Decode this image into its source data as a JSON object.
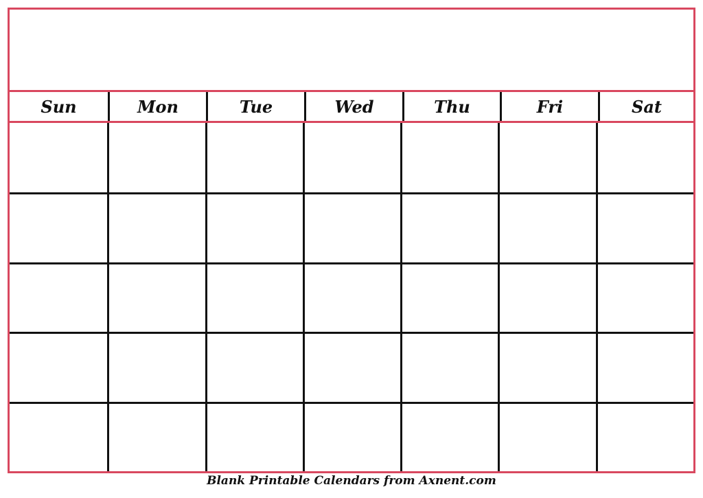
{
  "calendar": {
    "title": "",
    "weekdays": [
      "Sun",
      "Mon",
      "Tue",
      "Wed",
      "Thu",
      "Fri",
      "Sat"
    ],
    "rows": 5,
    "cells": [
      [
        "",
        "",
        "",
        "",
        "",
        "",
        ""
      ],
      [
        "",
        "",
        "",
        "",
        "",
        "",
        ""
      ],
      [
        "",
        "",
        "",
        "",
        "",
        "",
        ""
      ],
      [
        "",
        "",
        "",
        "",
        "",
        "",
        ""
      ],
      [
        "",
        "",
        "",
        "",
        "",
        "",
        ""
      ]
    ],
    "accent_color": "#d9485f",
    "grid_color": "#111111"
  },
  "footer": {
    "credit": "Blank Printable Calendars from Axnent.com"
  }
}
